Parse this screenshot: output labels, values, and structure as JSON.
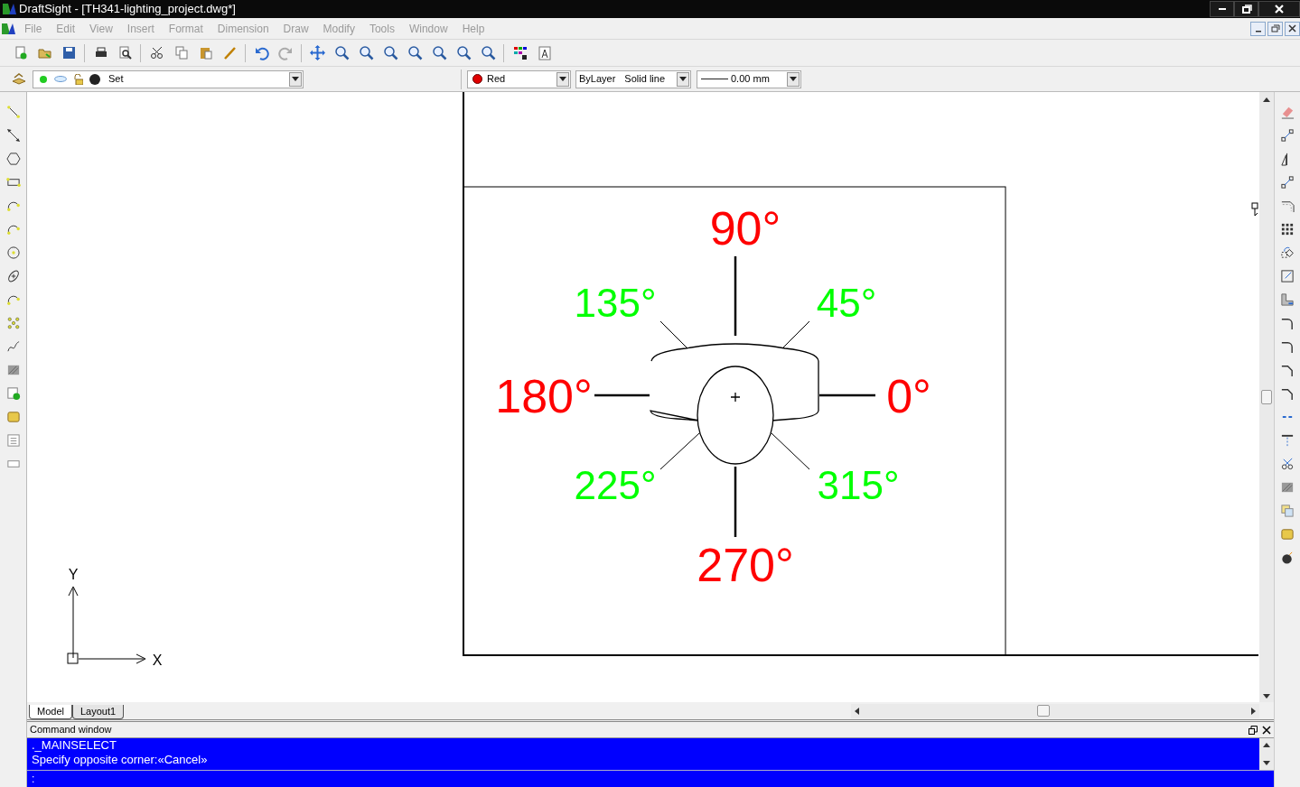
{
  "window": {
    "title": "DraftSight - [TH341-lighting_project.dwg*]"
  },
  "menu": [
    "File",
    "Edit",
    "View",
    "Insert",
    "Format",
    "Dimension",
    "Draw",
    "Modify",
    "Tools",
    "Window",
    "Help"
  ],
  "properties_bar": {
    "layer": "Set",
    "color": {
      "label": "Red",
      "color": "#e00000"
    },
    "line_color": "ByLayer",
    "line_style": "Solid line",
    "line_weight": "0.00 mm"
  },
  "drawing": {
    "angle_labels": [
      {
        "text": "90°",
        "color": "#ff0000",
        "kind": "major"
      },
      {
        "text": "135°",
        "color": "#00ff00",
        "kind": "minor"
      },
      {
        "text": "45°",
        "color": "#00ff00",
        "kind": "minor"
      },
      {
        "text": "180°",
        "color": "#ff0000",
        "kind": "major"
      },
      {
        "text": "0°",
        "color": "#ff0000",
        "kind": "major"
      },
      {
        "text": "225°",
        "color": "#00ff00",
        "kind": "minor"
      },
      {
        "text": "315°",
        "color": "#00ff00",
        "kind": "minor"
      },
      {
        "text": "270°",
        "color": "#ff0000",
        "kind": "major"
      }
    ],
    "axis_labels": [
      "Y",
      "X"
    ]
  },
  "sheet_tabs": [
    {
      "label": "Model",
      "selected": true
    },
    {
      "label": "Layout1",
      "selected": false
    }
  ],
  "command_window": {
    "title": "Command window",
    "lines": [
      "._MAINSELECT",
      "Specify opposite corner:«Cancel»"
    ],
    "prompt": ":"
  }
}
